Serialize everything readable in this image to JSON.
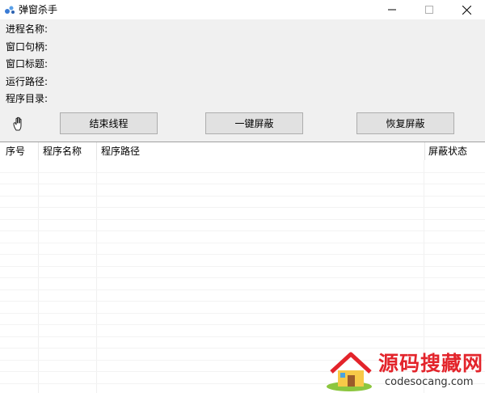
{
  "window": {
    "title": "弹窗杀手"
  },
  "fields": [
    {
      "label": "进程名称:",
      "value": ""
    },
    {
      "label": "窗口句柄:",
      "value": ""
    },
    {
      "label": "窗口标题:",
      "value": ""
    },
    {
      "label": "运行路径:",
      "value": ""
    },
    {
      "label": "程序目录:",
      "value": ""
    }
  ],
  "buttons": {
    "end_process": "结束线程",
    "block_all": "一键屏蔽",
    "restore_block": "恢复屏蔽"
  },
  "table": {
    "columns": [
      "序号",
      "程序名称",
      "程序路径",
      "屏蔽状态"
    ],
    "rows": []
  },
  "icons": {
    "app": "app-icon",
    "drag_target": "hand-icon",
    "minimize": "minimize-icon",
    "maximize": "maximize-icon",
    "close": "close-icon"
  },
  "watermark": {
    "text": "源码搜藏网",
    "url": "codesocang.com"
  },
  "colors": {
    "window_bg": "#f0f0f0",
    "button_bg": "#e1e1e1",
    "button_border": "#adadad",
    "table_bg": "#ffffff",
    "watermark_red": "#e3242b"
  }
}
